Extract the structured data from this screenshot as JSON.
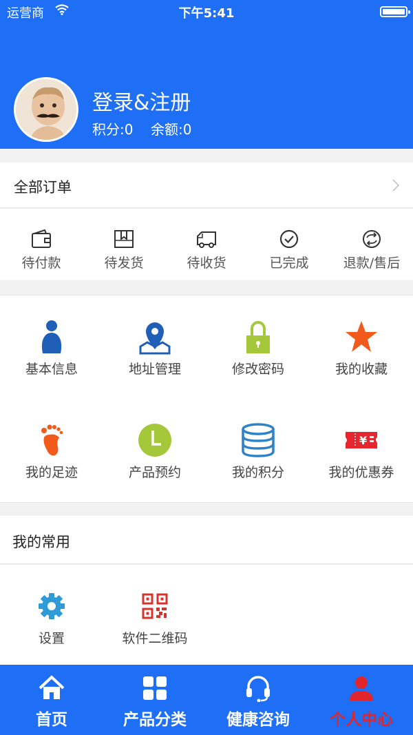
{
  "status_bar": {
    "carrier": "运营商",
    "time": "下午5:41"
  },
  "profile": {
    "login_label": "登录&注册",
    "points": "积分:0",
    "balance": "余额:0"
  },
  "orders": {
    "title": "全部订单",
    "items": [
      {
        "label": "待付款",
        "icon": "wallet-icon"
      },
      {
        "label": "待发货",
        "icon": "package-icon"
      },
      {
        "label": "待收货",
        "icon": "truck-icon"
      },
      {
        "label": "已完成",
        "icon": "check-circle-icon"
      },
      {
        "label": "退款/售后",
        "icon": "refund-icon"
      }
    ]
  },
  "features": {
    "items": [
      {
        "label": "基本信息",
        "icon": "person-icon"
      },
      {
        "label": "地址管理",
        "icon": "map-pin-icon"
      },
      {
        "label": "修改密码",
        "icon": "lock-icon"
      },
      {
        "label": "我的收藏",
        "icon": "star-icon"
      },
      {
        "label": "我的足迹",
        "icon": "footprint-icon"
      },
      {
        "label": "产品预约",
        "icon": "clock-icon"
      },
      {
        "label": "我的积分",
        "icon": "coins-icon"
      },
      {
        "label": "我的优惠券",
        "icon": "coupon-icon"
      }
    ]
  },
  "common": {
    "title": "我的常用",
    "items": [
      {
        "label": "设置",
        "icon": "gear-icon"
      },
      {
        "label": "软件二维码",
        "icon": "qr-code-icon"
      }
    ]
  },
  "tabbar": {
    "items": [
      {
        "label": "首页",
        "icon": "home-icon",
        "active": false
      },
      {
        "label": "产品分类",
        "icon": "grid-icon",
        "active": false
      },
      {
        "label": "健康咨询",
        "icon": "headset-icon",
        "active": false
      },
      {
        "label": "个人中心",
        "icon": "user-icon",
        "active": true
      }
    ]
  },
  "colors": {
    "primary": "#1e6ff5",
    "active_tab": "#e0252b",
    "background": "#f2f2f2"
  }
}
